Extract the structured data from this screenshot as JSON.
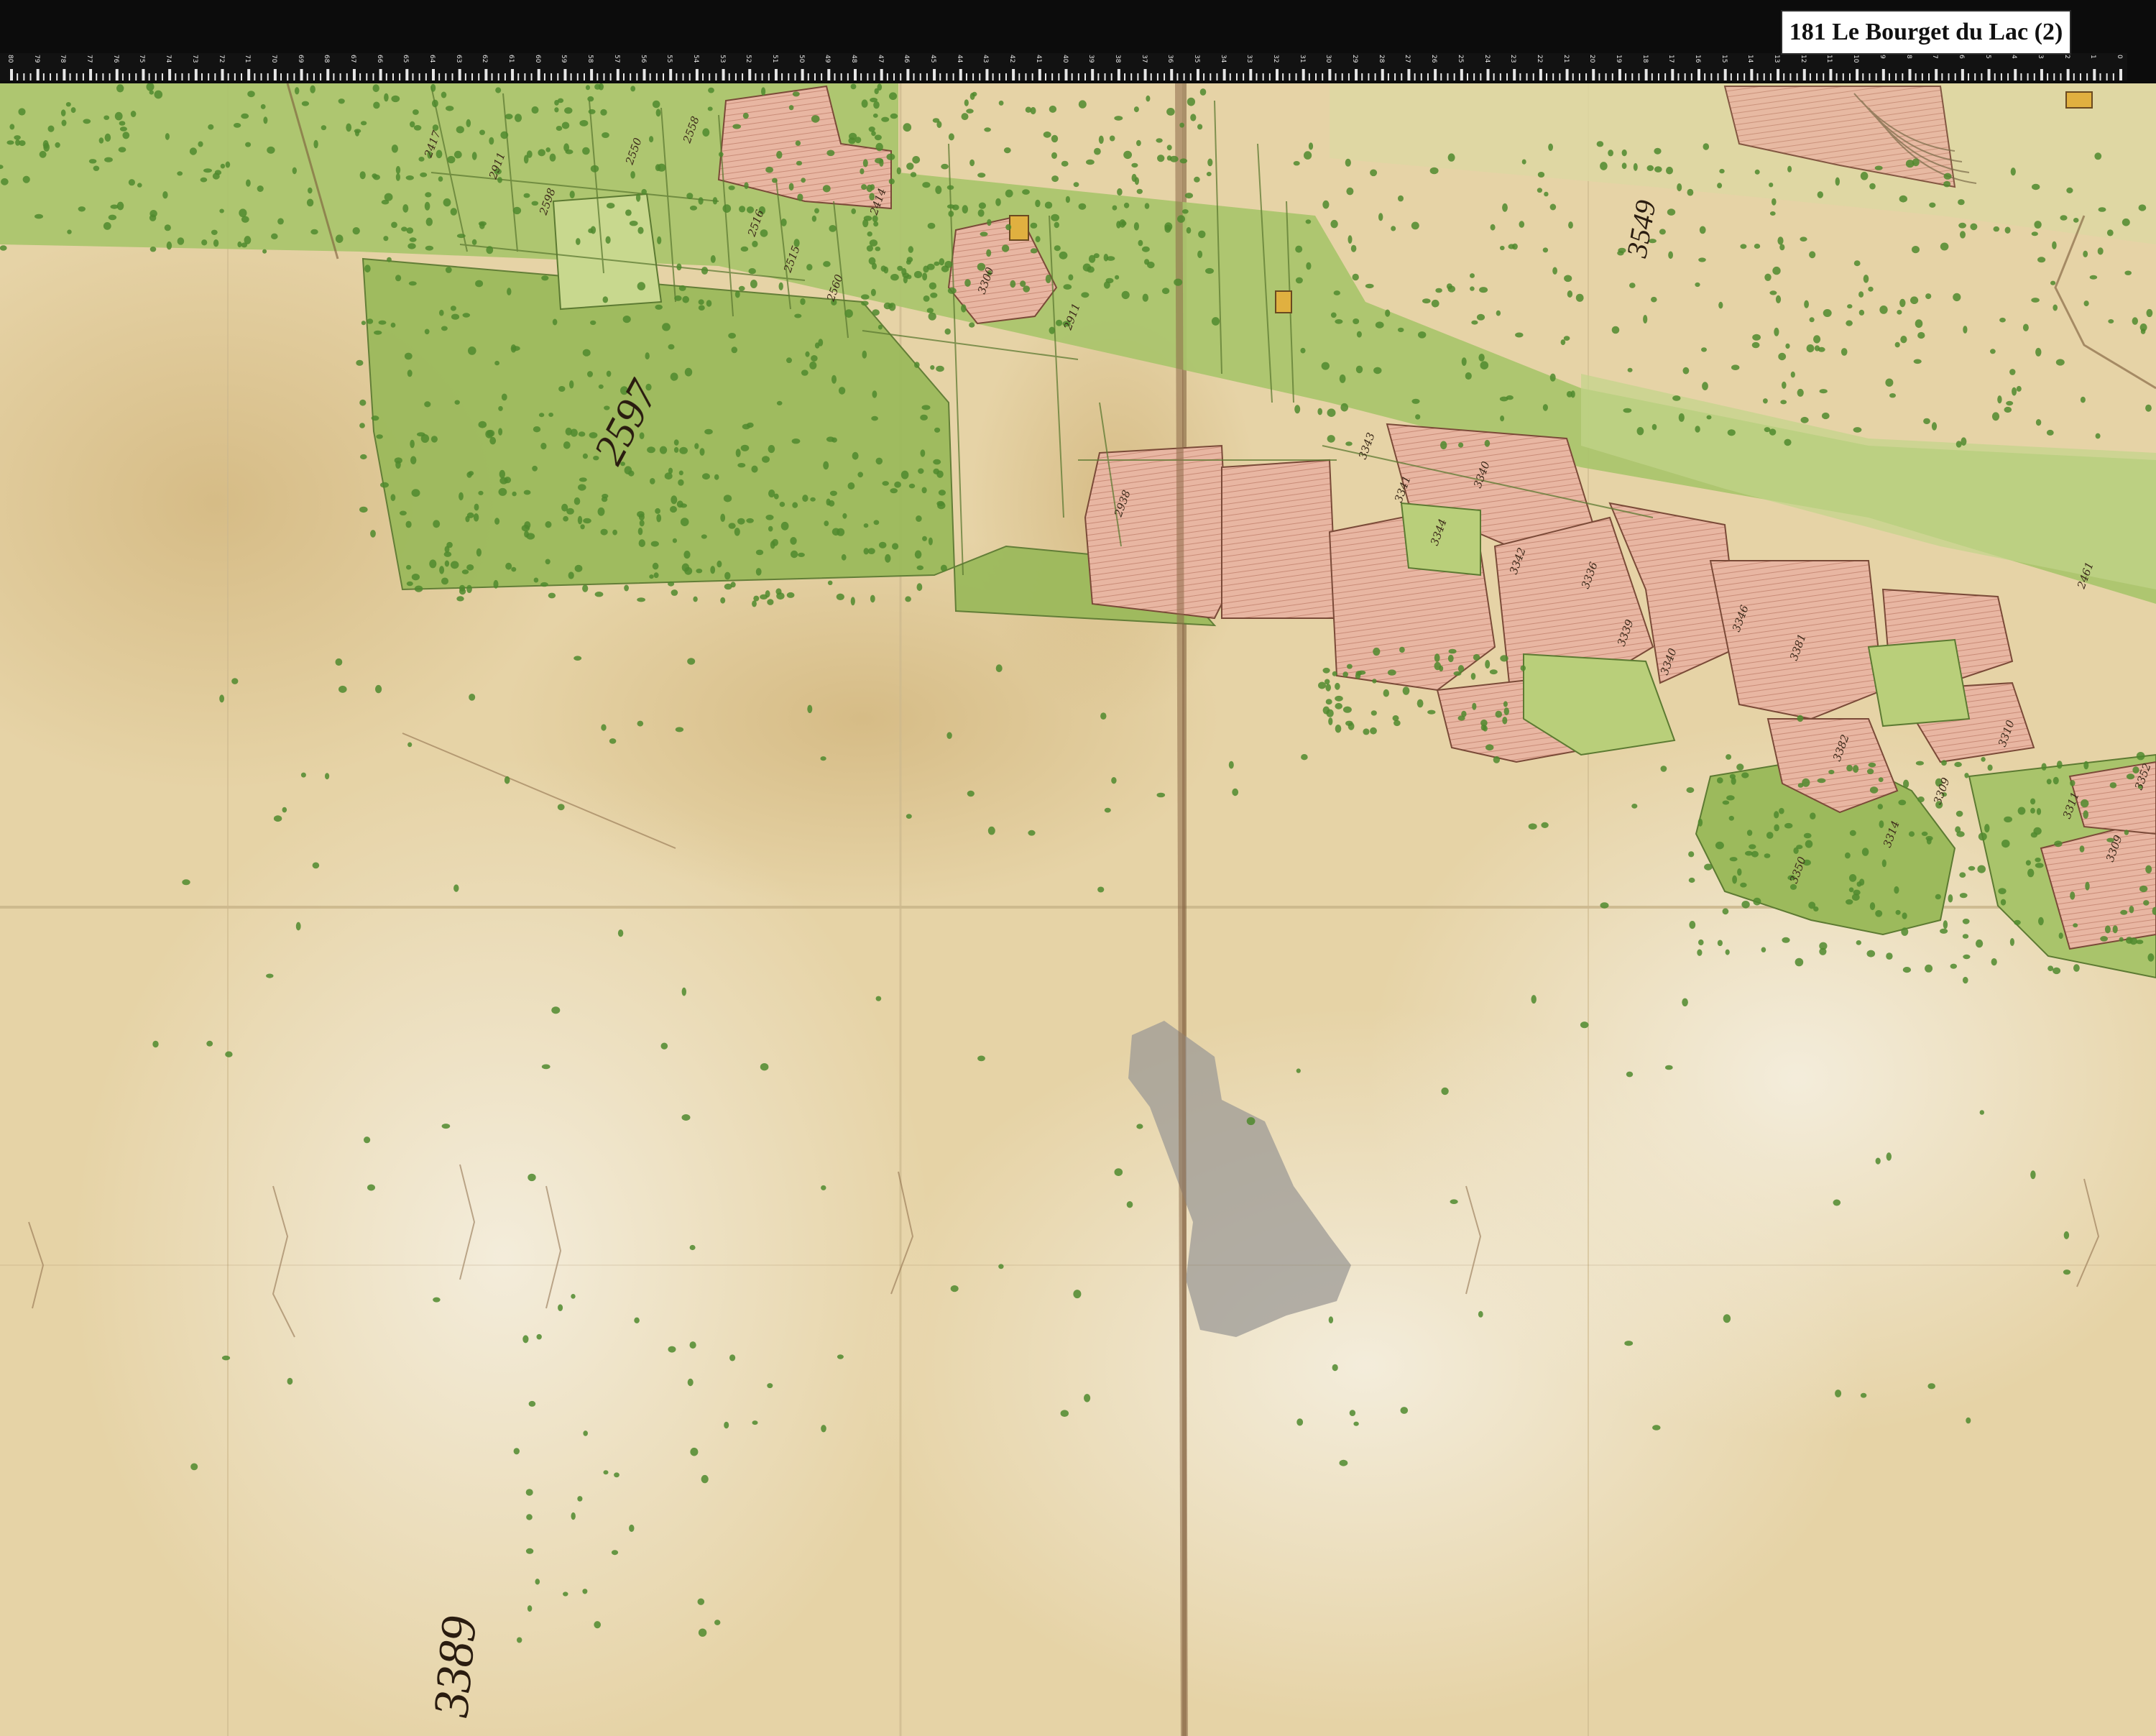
{
  "window": {
    "title": "181 Le Bourget du Lac (2)"
  },
  "ruler": {
    "labels": [
      "80",
      "79",
      "78",
      "77",
      "76",
      "75",
      "74",
      "73",
      "72",
      "71",
      "70",
      "69",
      "68",
      "67",
      "66",
      "65",
      "64",
      "63",
      "62",
      "61",
      "60",
      "59",
      "58",
      "57",
      "56",
      "55",
      "54",
      "53",
      "52",
      "51",
      "50",
      "49",
      "48",
      "47",
      "46",
      "45",
      "44",
      "43",
      "42",
      "41",
      "40",
      "39",
      "38",
      "37",
      "36",
      "35",
      "34",
      "33",
      "32",
      "31",
      "30",
      "29",
      "28",
      "27",
      "26",
      "25",
      "24",
      "23",
      "22",
      "21",
      "20",
      "19",
      "18",
      "17",
      "16",
      "15",
      "14",
      "13",
      "12",
      "11",
      "10",
      "9",
      "8",
      "7",
      "6",
      "5",
      "4",
      "3",
      "2",
      "1",
      "0"
    ]
  },
  "map": {
    "large_parcels": [
      {
        "id": "parcel-2597",
        "label": "2597"
      },
      {
        "id": "parcel-3549",
        "label": "3549"
      },
      {
        "id": "parcel-3389",
        "label": "3389"
      }
    ],
    "small_parcels": [
      "2417",
      "2911",
      "2598",
      "2550",
      "2558",
      "2516",
      "2515",
      "2560",
      "2414",
      "3300",
      "2911",
      "2938",
      "3343",
      "3341",
      "3344",
      "3340",
      "3342",
      "3336",
      "3339",
      "3340",
      "3346",
      "3381",
      "3382",
      "3350",
      "3314",
      "3309",
      "3310",
      "3311",
      "3309",
      "3352",
      "2461"
    ],
    "colors": {
      "parchment": "#ecdcb6",
      "woodland": "#9cba5c",
      "field_pink": "#e8b6a2",
      "meadow": "#b9cf7a",
      "ink": "#3c2a1a",
      "tree_dot": "#4f8a2e",
      "ruler_bar": "#0c0c0c"
    }
  }
}
